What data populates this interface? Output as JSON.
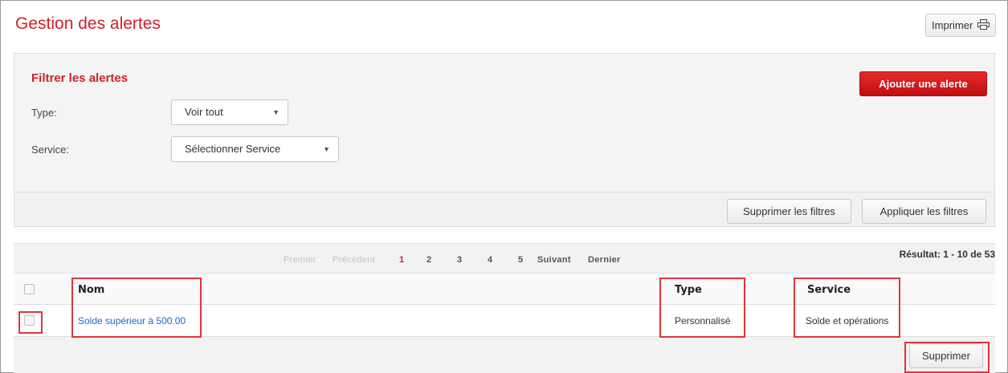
{
  "header": {
    "title": "Gestion des alertes",
    "print_label": "Imprimer"
  },
  "filters": {
    "title": "Filtrer les alertes",
    "add_label": "Ajouter une alerte",
    "type_label": "Type:",
    "type_value": "Voir tout",
    "service_label": "Service:",
    "service_value": "Sélectionner Service",
    "clear_label": "Supprimer les filtres",
    "apply_label": "Appliquer les filtres"
  },
  "pagination": {
    "first": "Premier",
    "previous": "Précédent",
    "pages": [
      "1",
      "2",
      "3",
      "4",
      "5"
    ],
    "current_page": "1",
    "next": "Suivant",
    "last": "Dernier",
    "result_text": "Résultat: 1 - 10 de 53"
  },
  "table": {
    "columns": [
      "Nom",
      "Type",
      "Service"
    ],
    "rows": [
      {
        "nom": "Solde supérieur à 500.00",
        "type": "Personnalisé",
        "service": "Solde et opérations"
      }
    ],
    "delete_label": "Supprimer"
  },
  "colors": {
    "accent": "#d0202a",
    "link": "#2563c9",
    "highlight": "#e0343a"
  }
}
